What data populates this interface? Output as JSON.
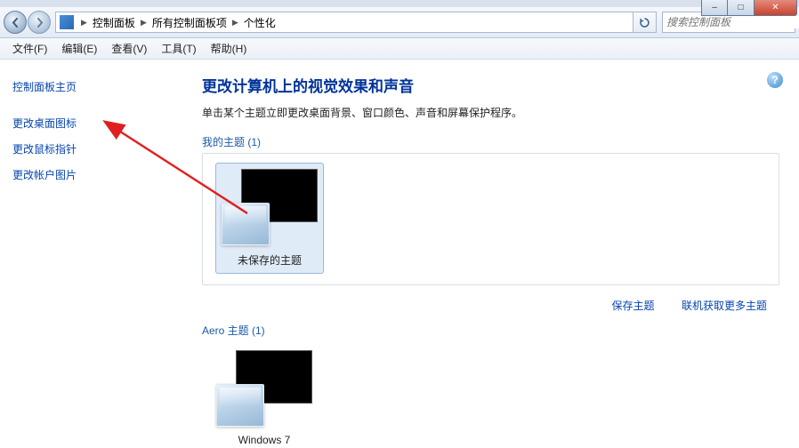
{
  "window_controls": {
    "min": "–",
    "max": "□",
    "close": "✕"
  },
  "breadcrumb": {
    "items": [
      "控制面板",
      "所有控制面板项",
      "个性化"
    ],
    "sep": "▶"
  },
  "search": {
    "placeholder": "搜索控制面板"
  },
  "menu": {
    "file": "文件(F)",
    "edit": "编辑(E)",
    "view": "查看(V)",
    "tools": "工具(T)",
    "help": "帮助(H)"
  },
  "sidebar": {
    "home": "控制面板主页",
    "links": [
      "更改桌面图标",
      "更改鼠标指针",
      "更改帐户图片"
    ]
  },
  "page": {
    "title": "更改计算机上的视觉效果和声音",
    "subtitle": "单击某个主题立即更改桌面背景、窗口颜色、声音和屏幕保护程序。"
  },
  "sections": {
    "my_themes_label": "我的主题 (1)",
    "my_themes": [
      {
        "name": "未保存的主题"
      }
    ],
    "aero_label": "Aero 主题 (1)",
    "aero_themes": [
      {
        "name": "Windows 7"
      }
    ]
  },
  "actions": {
    "save": "保存主题",
    "more": "联机获取更多主题"
  },
  "help_glyph": "?"
}
